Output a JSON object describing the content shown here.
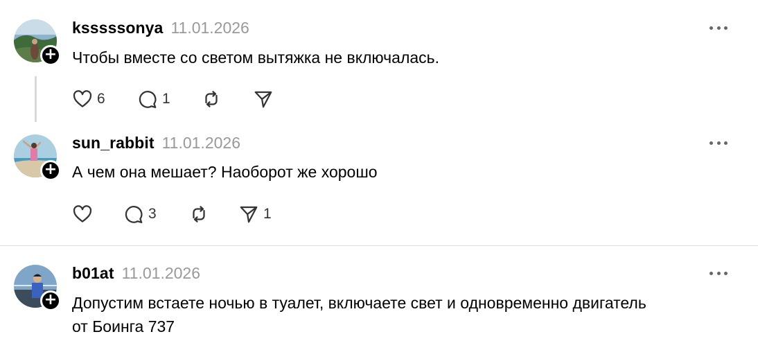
{
  "posts": [
    {
      "username": "ksssssonya",
      "date": "11.01.2026",
      "text": "Чтобы вместе со светом вытяжка не включалась.",
      "likes": "6",
      "replies": "1",
      "reposts": "",
      "shares": ""
    },
    {
      "username": "sun_rabbit",
      "date": "11.01.2026",
      "text": "А чем она мешает? Наоборот же хорошо",
      "likes": "",
      "replies": "3",
      "reposts": "",
      "shares": "1"
    },
    {
      "username": "b01at",
      "date": "11.01.2026",
      "text_line1": "Допустим встаете ночью в туалет, включаете свет и одновременно двигатель",
      "text_line2": "от Боинга 737"
    }
  ],
  "icons": {
    "like": "heart-icon",
    "reply": "comment-icon",
    "repost": "repost-icon",
    "share": "send-icon",
    "more": "more-icon",
    "follow": "plus-icon"
  },
  "colors": {
    "text": "#000000",
    "muted": "#999999",
    "icon": "#333333",
    "divider": "#dddddd"
  }
}
